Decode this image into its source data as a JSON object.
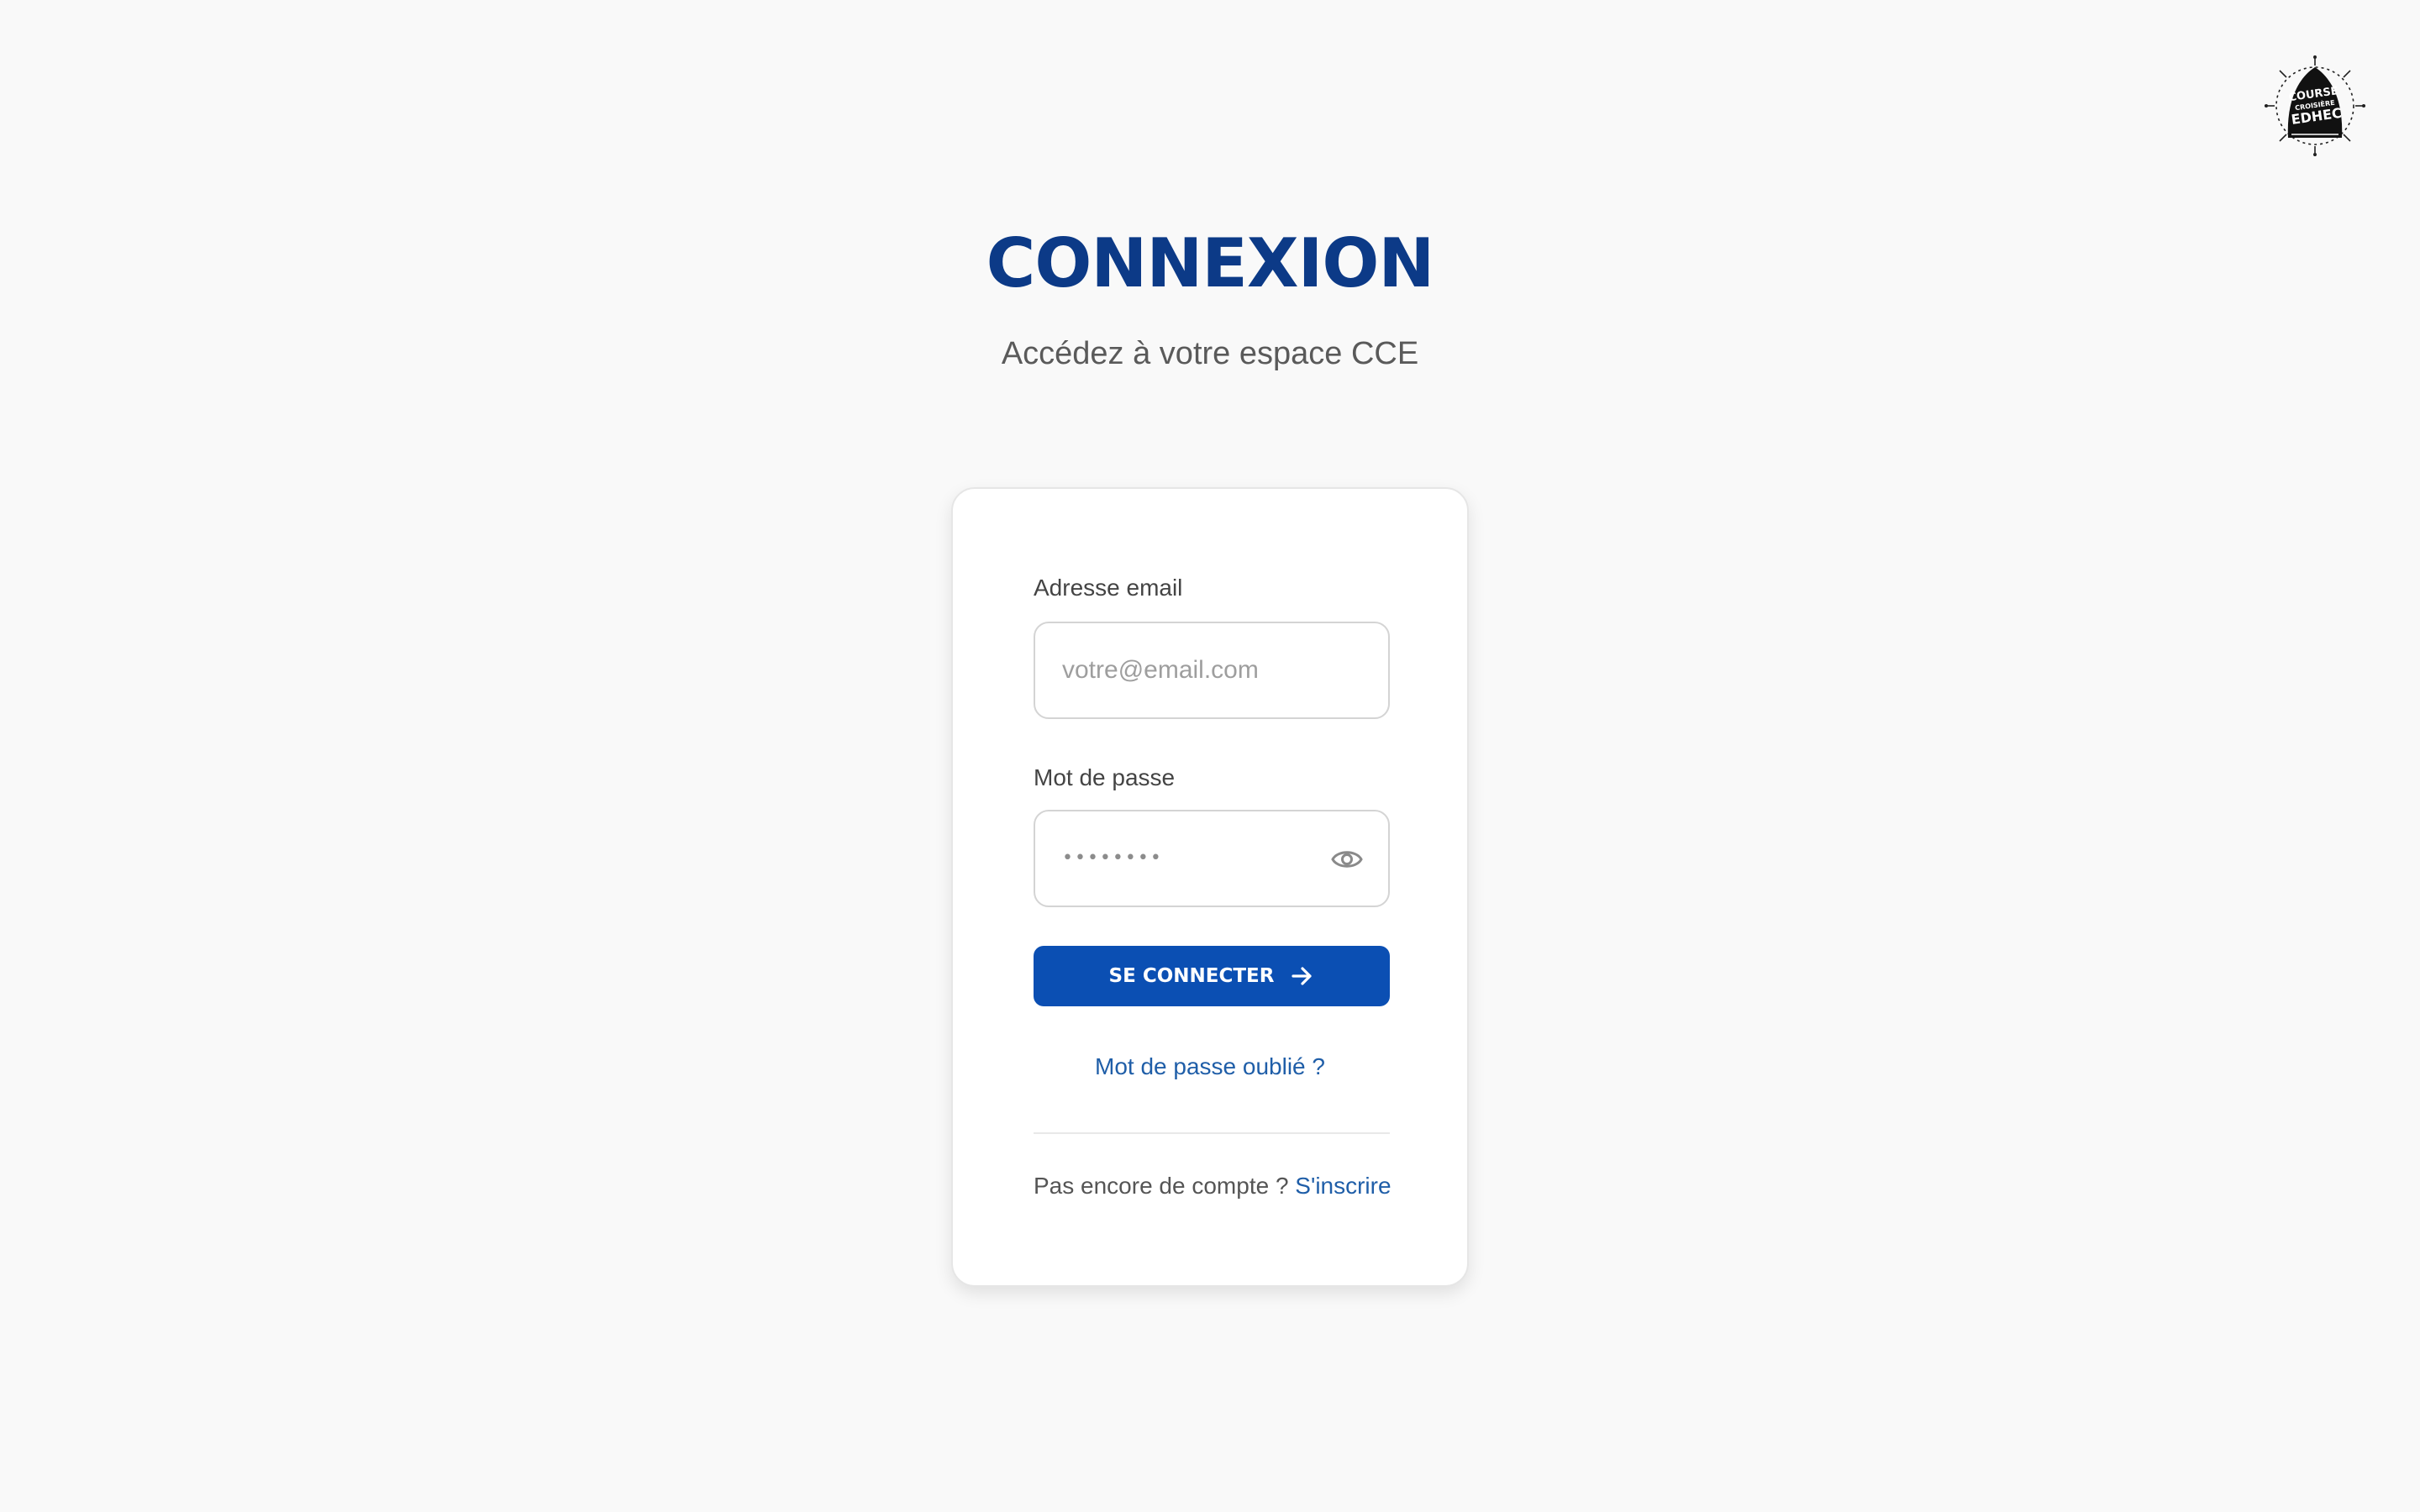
{
  "logo": {
    "icon": "course-croisiere-edhec-logo",
    "text_lines": [
      "COURSE",
      "CROISIÈRE",
      "EDHEC"
    ]
  },
  "header": {
    "title": "CONNEXION",
    "subtitle": "Accédez à votre espace CCE"
  },
  "form": {
    "email": {
      "label": "Adresse email",
      "placeholder": "votre@email.com",
      "value": ""
    },
    "password": {
      "label": "Mot de passe",
      "masked_value": "••••••••",
      "toggle_icon": "eye-icon"
    },
    "submit": {
      "label": "SE CONNECTER",
      "icon": "arrow-right-icon"
    },
    "forgot_password": "Mot de passe oublié ?",
    "signup": {
      "prompt": "Pas encore de compte ?",
      "link": "S'inscrire"
    }
  },
  "colors": {
    "background": "#f9f9f9",
    "title": "#0c3a87",
    "primary_button": "#0b4fb3",
    "link": "#1f5ea8",
    "card": "#ffffff"
  }
}
